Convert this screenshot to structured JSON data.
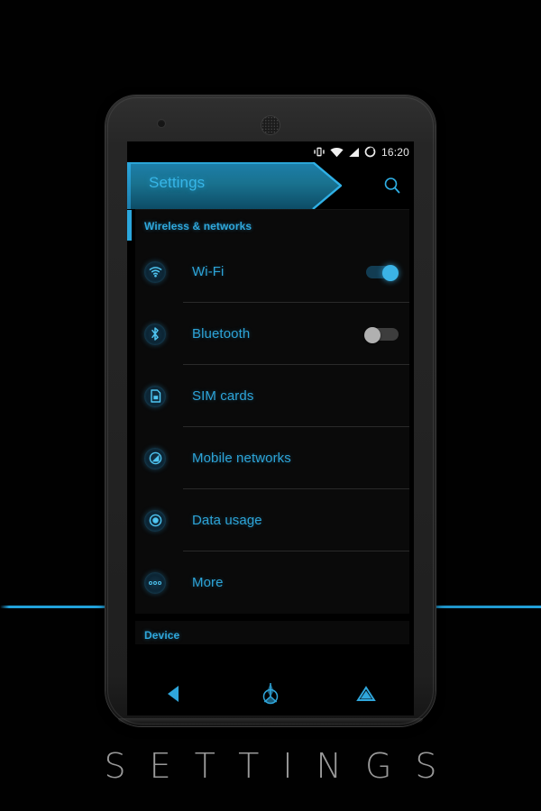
{
  "statusbar": {
    "time": "16:20",
    "icons": [
      "vibrate-icon",
      "wifi-icon",
      "signal-icon",
      "battery-icon"
    ]
  },
  "actionbar": {
    "title": "Settings",
    "search_icon": "search-icon"
  },
  "sections": [
    {
      "header": "Wireless & networks",
      "rows": [
        {
          "label": "Wi-Fi",
          "icon": "wifi-icon",
          "toggle": "on"
        },
        {
          "label": "Bluetooth",
          "icon": "bluetooth-icon",
          "toggle": "off"
        },
        {
          "label": "SIM cards",
          "icon": "sim-card-icon",
          "toggle": null
        },
        {
          "label": "Mobile networks",
          "icon": "mobile-network-icon",
          "toggle": null
        },
        {
          "label": "Data usage",
          "icon": "data-usage-icon",
          "toggle": null
        },
        {
          "label": "More",
          "icon": "more-icon",
          "toggle": null
        }
      ]
    },
    {
      "header": "Device",
      "rows": []
    }
  ],
  "navbar": {
    "back": "back-icon",
    "home": "home-icon",
    "recents": "recents-icon"
  },
  "caption": "SETTINGS",
  "colors": {
    "accent": "#2ba7dd",
    "accent_text": "#2da4d8",
    "screen_bg": "#000000",
    "card_bg": "#0a0a0a",
    "toggle_on_knob": "#3bb3e6",
    "toggle_off_knob": "#b0b0b0"
  }
}
